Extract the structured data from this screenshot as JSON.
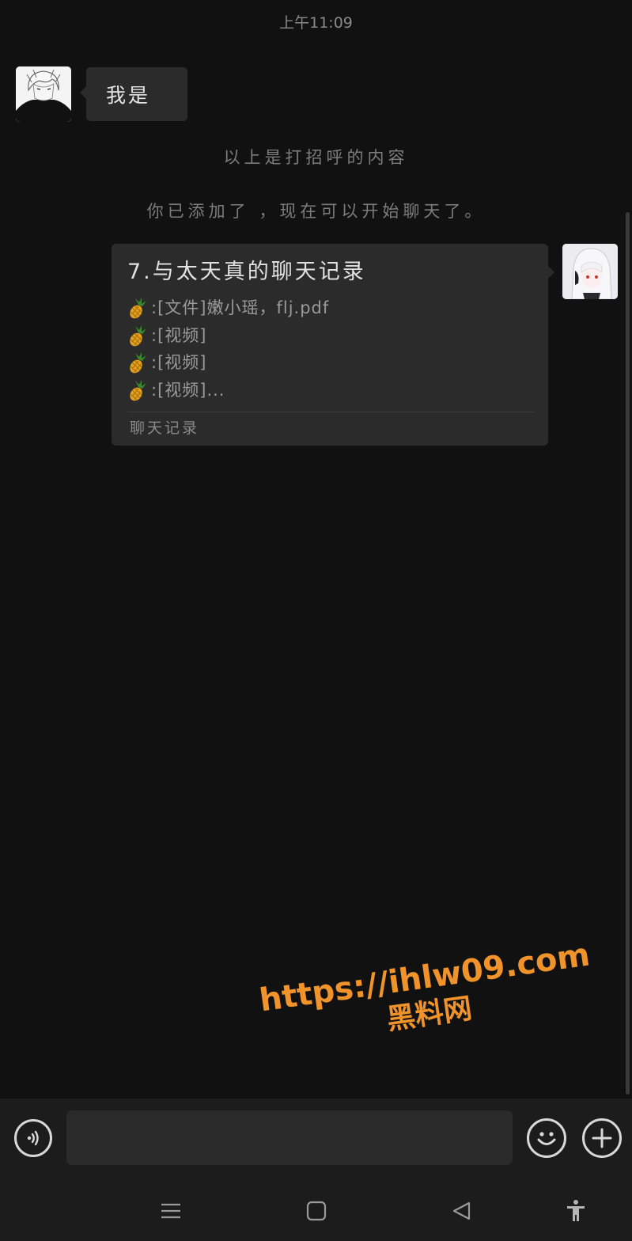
{
  "status": {
    "time": "上午11:09"
  },
  "messages": {
    "incoming_text": "我是",
    "system_greeting_note": "以上是打招呼的内容",
    "system_added_note": "你已添加了  ，现在可以开始聊天了。"
  },
  "chat_record_card": {
    "title": "7.与太天真的聊天记录",
    "lines": [
      ":[文件]嫩小瑶，flj.pdf",
      ":[视频]",
      ":[视频]",
      ":[视频]..."
    ],
    "line_icon": "pineapple-emoji",
    "footer": "聊天记录"
  },
  "watermark": {
    "url": "https://ihlw09.com",
    "name": "黑料网",
    "color": "#f0932a"
  },
  "input_bar": {
    "text_value": "",
    "icons": [
      "voice-icon",
      "emoji-icon",
      "plus-icon"
    ]
  },
  "nav_bar": {
    "icons": [
      "menu-icon",
      "home-icon",
      "back-icon",
      "accessibility-icon"
    ]
  }
}
